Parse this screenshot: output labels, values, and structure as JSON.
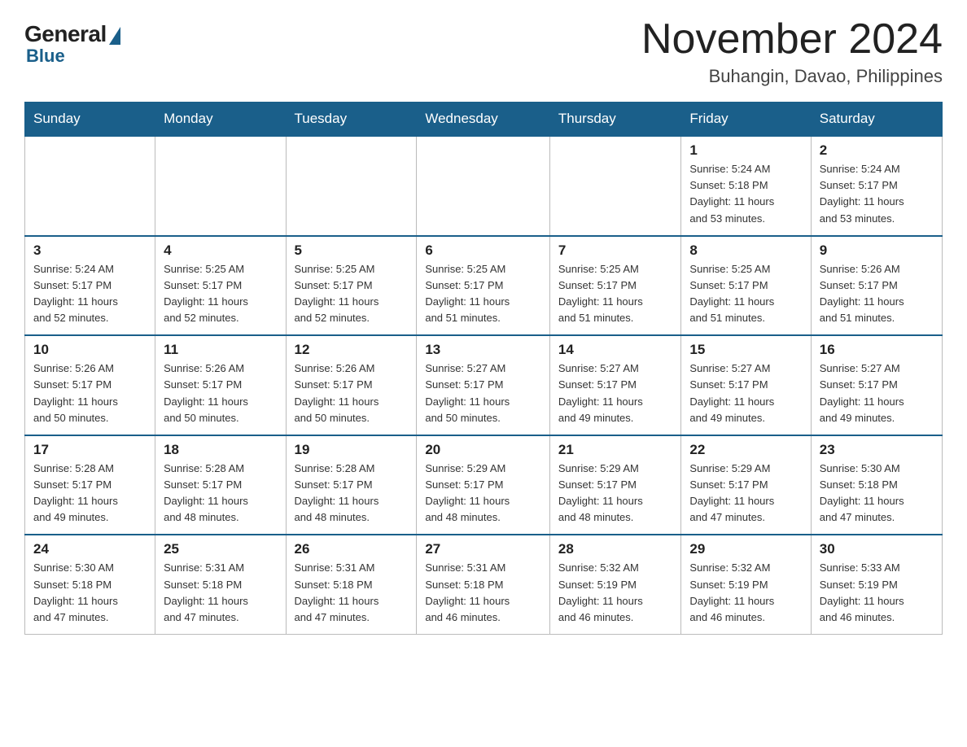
{
  "logo": {
    "general": "General",
    "blue": "Blue"
  },
  "title": "November 2024",
  "location": "Buhangin, Davao, Philippines",
  "weekdays": [
    "Sunday",
    "Monday",
    "Tuesday",
    "Wednesday",
    "Thursday",
    "Friday",
    "Saturday"
  ],
  "weeks": [
    [
      {
        "day": "",
        "info": ""
      },
      {
        "day": "",
        "info": ""
      },
      {
        "day": "",
        "info": ""
      },
      {
        "day": "",
        "info": ""
      },
      {
        "day": "",
        "info": ""
      },
      {
        "day": "1",
        "info": "Sunrise: 5:24 AM\nSunset: 5:18 PM\nDaylight: 11 hours\nand 53 minutes."
      },
      {
        "day": "2",
        "info": "Sunrise: 5:24 AM\nSunset: 5:17 PM\nDaylight: 11 hours\nand 53 minutes."
      }
    ],
    [
      {
        "day": "3",
        "info": "Sunrise: 5:24 AM\nSunset: 5:17 PM\nDaylight: 11 hours\nand 52 minutes."
      },
      {
        "day": "4",
        "info": "Sunrise: 5:25 AM\nSunset: 5:17 PM\nDaylight: 11 hours\nand 52 minutes."
      },
      {
        "day": "5",
        "info": "Sunrise: 5:25 AM\nSunset: 5:17 PM\nDaylight: 11 hours\nand 52 minutes."
      },
      {
        "day": "6",
        "info": "Sunrise: 5:25 AM\nSunset: 5:17 PM\nDaylight: 11 hours\nand 51 minutes."
      },
      {
        "day": "7",
        "info": "Sunrise: 5:25 AM\nSunset: 5:17 PM\nDaylight: 11 hours\nand 51 minutes."
      },
      {
        "day": "8",
        "info": "Sunrise: 5:25 AM\nSunset: 5:17 PM\nDaylight: 11 hours\nand 51 minutes."
      },
      {
        "day": "9",
        "info": "Sunrise: 5:26 AM\nSunset: 5:17 PM\nDaylight: 11 hours\nand 51 minutes."
      }
    ],
    [
      {
        "day": "10",
        "info": "Sunrise: 5:26 AM\nSunset: 5:17 PM\nDaylight: 11 hours\nand 50 minutes."
      },
      {
        "day": "11",
        "info": "Sunrise: 5:26 AM\nSunset: 5:17 PM\nDaylight: 11 hours\nand 50 minutes."
      },
      {
        "day": "12",
        "info": "Sunrise: 5:26 AM\nSunset: 5:17 PM\nDaylight: 11 hours\nand 50 minutes."
      },
      {
        "day": "13",
        "info": "Sunrise: 5:27 AM\nSunset: 5:17 PM\nDaylight: 11 hours\nand 50 minutes."
      },
      {
        "day": "14",
        "info": "Sunrise: 5:27 AM\nSunset: 5:17 PM\nDaylight: 11 hours\nand 49 minutes."
      },
      {
        "day": "15",
        "info": "Sunrise: 5:27 AM\nSunset: 5:17 PM\nDaylight: 11 hours\nand 49 minutes."
      },
      {
        "day": "16",
        "info": "Sunrise: 5:27 AM\nSunset: 5:17 PM\nDaylight: 11 hours\nand 49 minutes."
      }
    ],
    [
      {
        "day": "17",
        "info": "Sunrise: 5:28 AM\nSunset: 5:17 PM\nDaylight: 11 hours\nand 49 minutes."
      },
      {
        "day": "18",
        "info": "Sunrise: 5:28 AM\nSunset: 5:17 PM\nDaylight: 11 hours\nand 48 minutes."
      },
      {
        "day": "19",
        "info": "Sunrise: 5:28 AM\nSunset: 5:17 PM\nDaylight: 11 hours\nand 48 minutes."
      },
      {
        "day": "20",
        "info": "Sunrise: 5:29 AM\nSunset: 5:17 PM\nDaylight: 11 hours\nand 48 minutes."
      },
      {
        "day": "21",
        "info": "Sunrise: 5:29 AM\nSunset: 5:17 PM\nDaylight: 11 hours\nand 48 minutes."
      },
      {
        "day": "22",
        "info": "Sunrise: 5:29 AM\nSunset: 5:17 PM\nDaylight: 11 hours\nand 47 minutes."
      },
      {
        "day": "23",
        "info": "Sunrise: 5:30 AM\nSunset: 5:18 PM\nDaylight: 11 hours\nand 47 minutes."
      }
    ],
    [
      {
        "day": "24",
        "info": "Sunrise: 5:30 AM\nSunset: 5:18 PM\nDaylight: 11 hours\nand 47 minutes."
      },
      {
        "day": "25",
        "info": "Sunrise: 5:31 AM\nSunset: 5:18 PM\nDaylight: 11 hours\nand 47 minutes."
      },
      {
        "day": "26",
        "info": "Sunrise: 5:31 AM\nSunset: 5:18 PM\nDaylight: 11 hours\nand 47 minutes."
      },
      {
        "day": "27",
        "info": "Sunrise: 5:31 AM\nSunset: 5:18 PM\nDaylight: 11 hours\nand 46 minutes."
      },
      {
        "day": "28",
        "info": "Sunrise: 5:32 AM\nSunset: 5:19 PM\nDaylight: 11 hours\nand 46 minutes."
      },
      {
        "day": "29",
        "info": "Sunrise: 5:32 AM\nSunset: 5:19 PM\nDaylight: 11 hours\nand 46 minutes."
      },
      {
        "day": "30",
        "info": "Sunrise: 5:33 AM\nSunset: 5:19 PM\nDaylight: 11 hours\nand 46 minutes."
      }
    ]
  ]
}
